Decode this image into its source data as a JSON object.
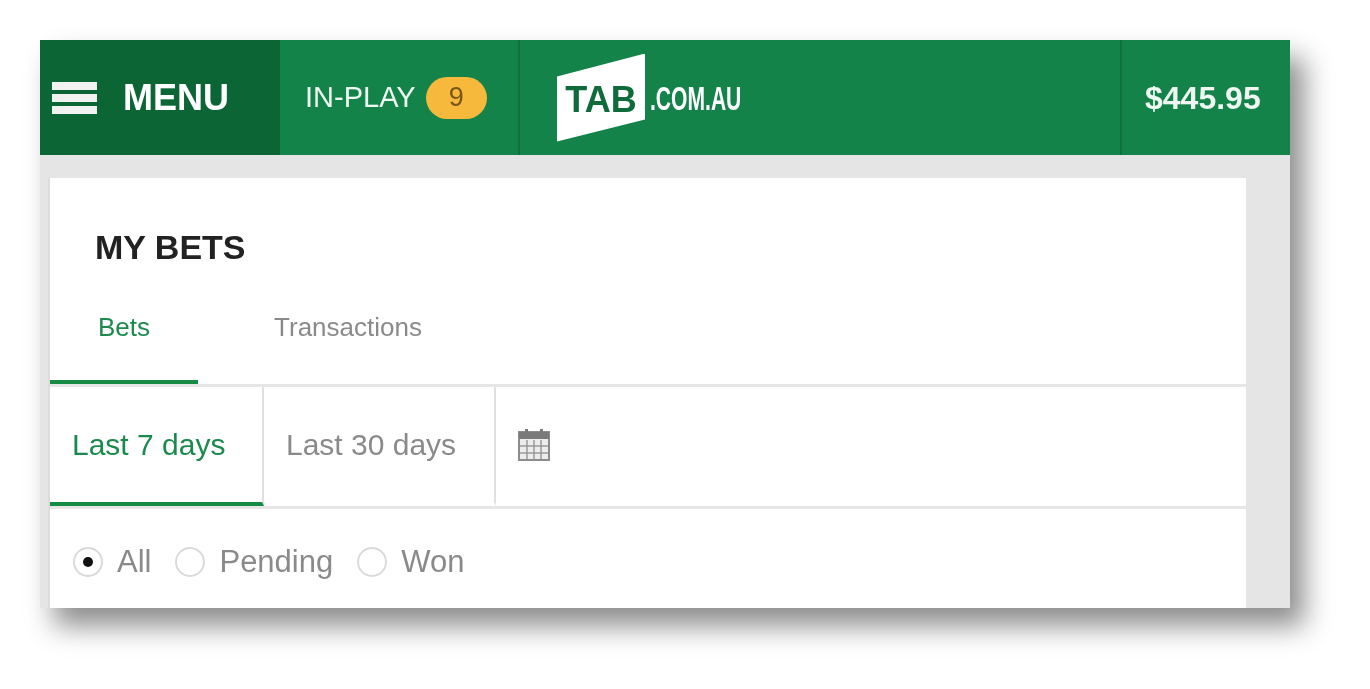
{
  "header": {
    "menu_button": {
      "label": "MENU"
    },
    "in_play": {
      "label": "IN-PLAY",
      "count": "9"
    },
    "logo": {
      "mark": "TAB",
      "domain": ".COM.AU"
    },
    "balance": "$445.95"
  },
  "page": {
    "title": "MY BETS",
    "tabs": [
      {
        "label": "Bets",
        "selected": true
      },
      {
        "label": "Transactions",
        "selected": false
      }
    ],
    "date_ranges": [
      {
        "kind": "text",
        "label": "Last 7 days",
        "selected": true
      },
      {
        "kind": "text",
        "label": "Last 30 days",
        "selected": false
      },
      {
        "kind": "calendar",
        "selected": false
      }
    ],
    "filters": [
      {
        "label": "All",
        "selected": true
      },
      {
        "label": "Pending",
        "selected": false
      },
      {
        "label": "Won",
        "selected": false
      }
    ]
  }
}
